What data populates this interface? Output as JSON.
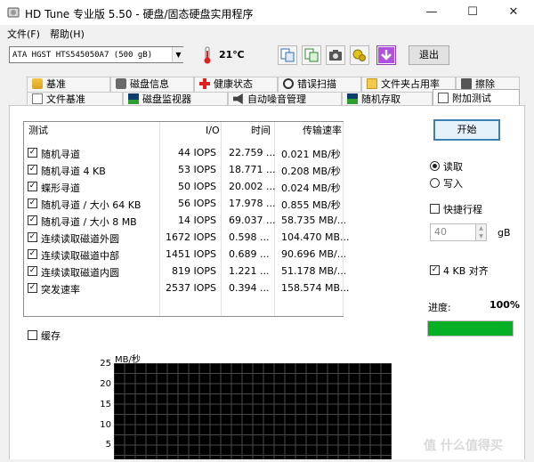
{
  "window": {
    "title": "HD Tune 专业版 5.50 - 硬盘/固态硬盘实用程序",
    "controls": {
      "minimize": "—",
      "maximize": "☐",
      "close": "✕"
    }
  },
  "menu": {
    "items": [
      "文件(F)",
      "帮助(H)"
    ]
  },
  "toolbar": {
    "drive": "ATA     HGST HTS545050A7 (500 gB)",
    "temperature": "21℃",
    "exit_label": "退出"
  },
  "tabs": {
    "row1": [
      "基准",
      "磁盘信息",
      "健康状态",
      "错误扫描",
      "文件夹占用率",
      "擦除"
    ],
    "row2": [
      "文件基准",
      "磁盘监视器",
      "自动噪音管理",
      "随机存取",
      "附加测试"
    ],
    "active": "附加测试"
  },
  "results": {
    "columns": [
      "测试",
      "I/O",
      "时间",
      "传输速率"
    ],
    "rows": [
      {
        "checked": true,
        "test": "随机寻道",
        "io": "44 IOPS",
        "time": "22.759 ...",
        "rate": "0.021 MB/秒"
      },
      {
        "checked": true,
        "test": "随机寻道 4 KB",
        "io": "53 IOPS",
        "time": "18.771 ...",
        "rate": "0.208 MB/秒"
      },
      {
        "checked": true,
        "test": "蝶形寻道",
        "io": "50 IOPS",
        "time": "20.002 ...",
        "rate": "0.024 MB/秒"
      },
      {
        "checked": true,
        "test": "随机寻道 / 大小 64 KB",
        "io": "56 IOPS",
        "time": "17.978 ...",
        "rate": "0.855 MB/秒"
      },
      {
        "checked": true,
        "test": "随机寻道 / 大小 8 MB",
        "io": "14 IOPS",
        "time": "69.037 ...",
        "rate": "58.735 MB/..."
      },
      {
        "checked": true,
        "test": "连续读取磁道外圆",
        "io": "1672 IOPS",
        "time": "0.598 ...",
        "rate": "104.470 MB..."
      },
      {
        "checked": true,
        "test": "连续读取磁道中部",
        "io": "1451 IOPS",
        "time": "0.689 ...",
        "rate": "90.696 MB/..."
      },
      {
        "checked": true,
        "test": "连续读取磁道内圆",
        "io": "819 IOPS",
        "time": "1.221 ...",
        "rate": "51.178 MB/..."
      },
      {
        "checked": true,
        "test": "突发速率",
        "io": "2537 IOPS",
        "time": "0.394 ...",
        "rate": "158.574 MB..."
      }
    ]
  },
  "controls": {
    "start_label": "开始",
    "mode_read": "读取",
    "mode_write": "写入",
    "mode_selected": "read",
    "short_stroke_label": "快捷行程",
    "short_stroke_checked": false,
    "short_stroke_value": "40",
    "short_stroke_unit": "gB",
    "align_4k_label": "4 KB 对齐",
    "align_4k_checked": true,
    "progress_label": "进度:",
    "progress_text": "100%",
    "progress_value": 1.0
  },
  "cache": {
    "label": "缓存",
    "checked": false
  },
  "graph": {
    "unit": "MB/秒",
    "yticks": [
      "25",
      "20",
      "15",
      "10",
      "5"
    ]
  },
  "watermark": "值 什么值得买",
  "colors": {
    "accent": "#3c7fb1",
    "progress": "#06b025",
    "graph_bg": "#000000",
    "graph_grid": "#4a4a4a"
  }
}
